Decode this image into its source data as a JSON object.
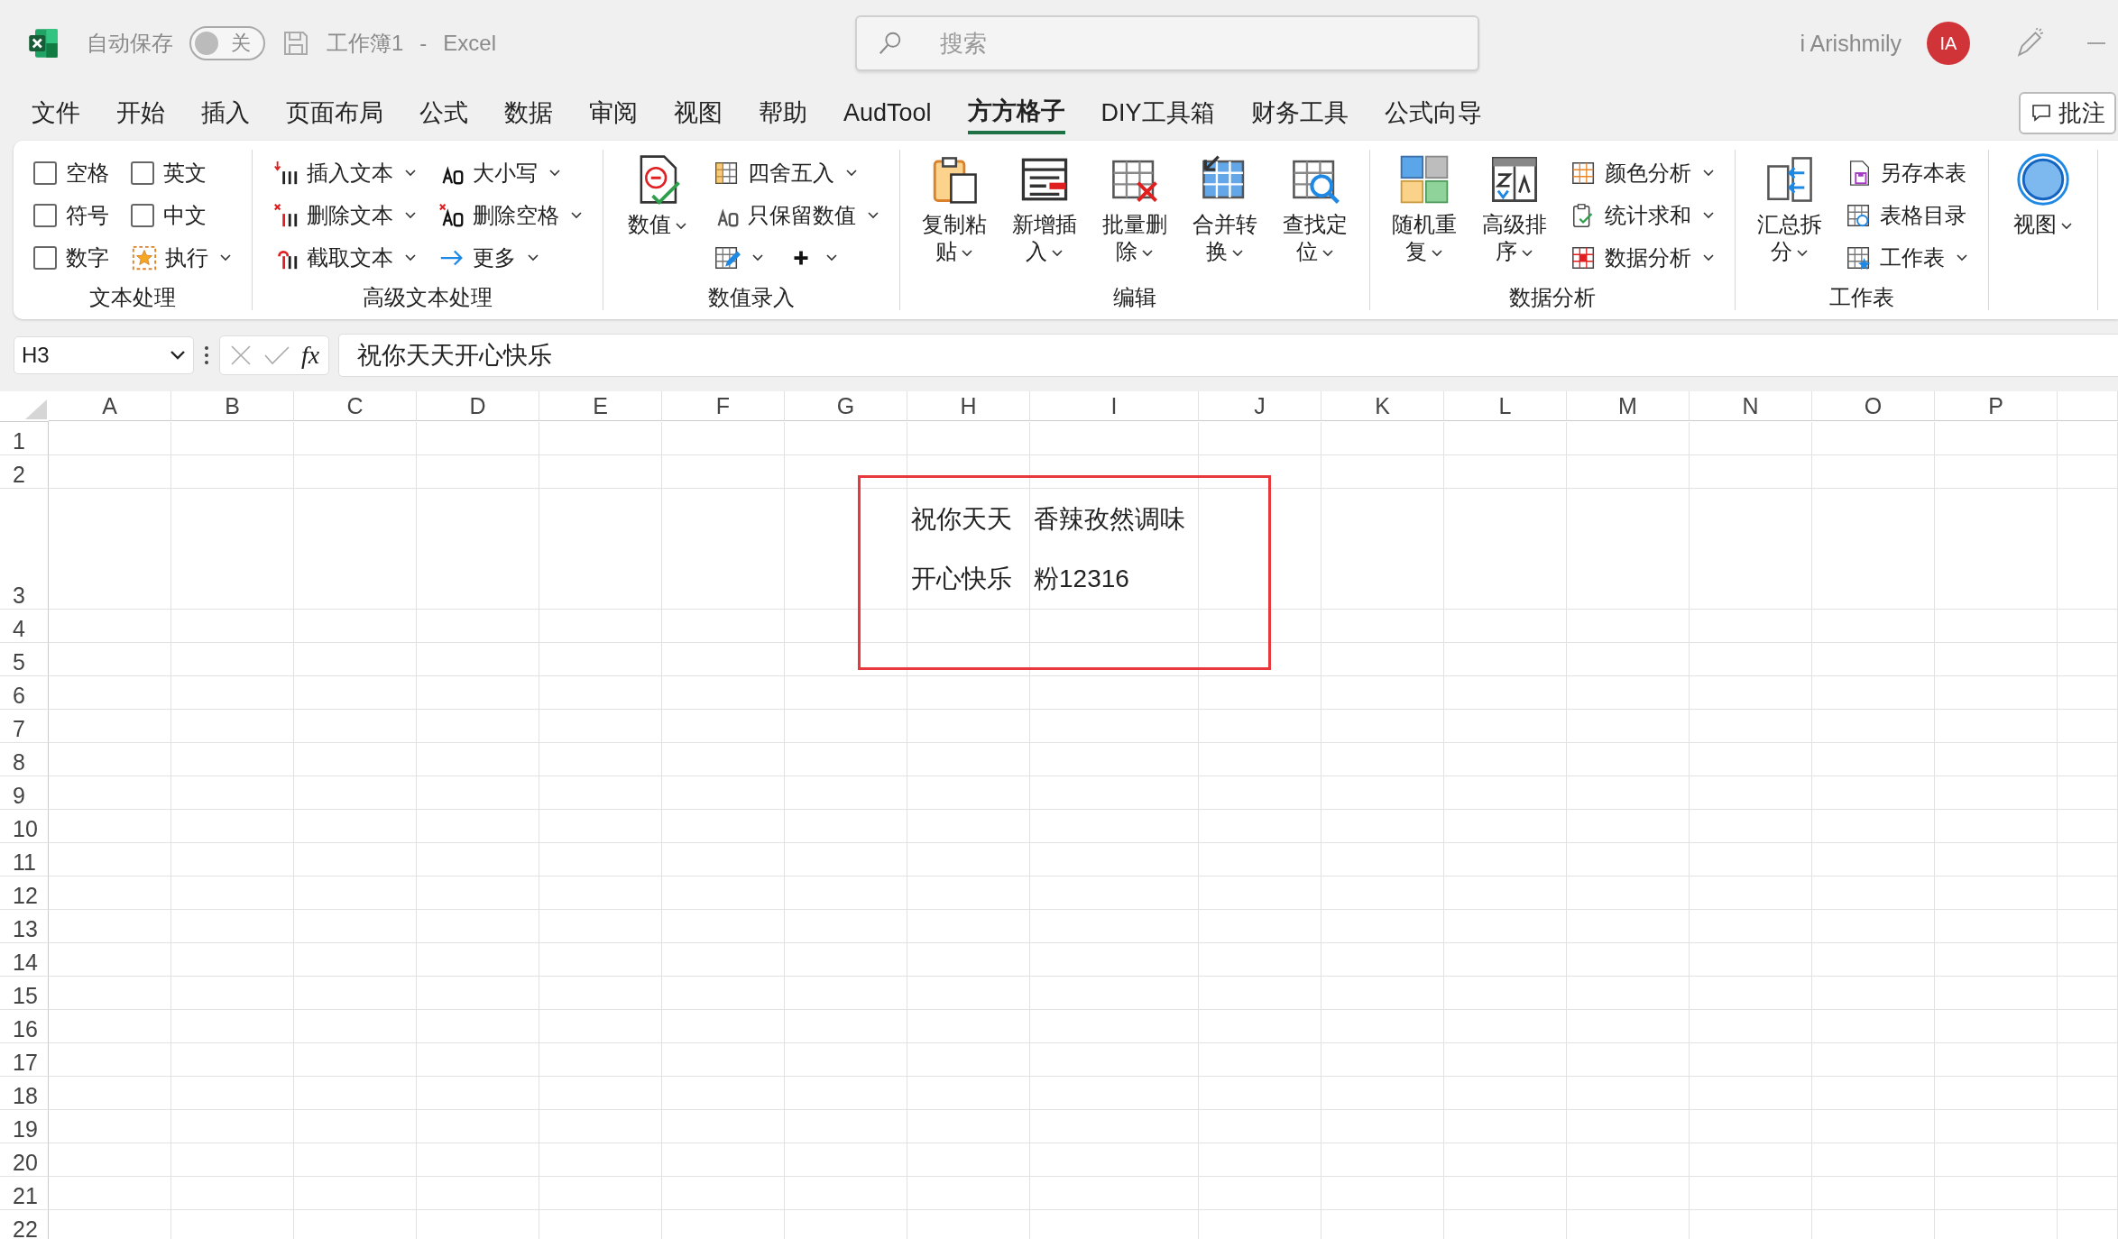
{
  "title_bar": {
    "autosave_label": "自动保存",
    "autosave_toggle": {
      "label": "关",
      "on": false
    },
    "document": "工作簿1",
    "separator": "-",
    "app": "Excel",
    "search": {
      "placeholder": "搜索"
    },
    "user": "i Arishmily",
    "avatar": "IA"
  },
  "menu_tabs": [
    {
      "label": "文件",
      "selected": false
    },
    {
      "label": "开始",
      "selected": false
    },
    {
      "label": "插入",
      "selected": false
    },
    {
      "label": "页面布局",
      "selected": false
    },
    {
      "label": "公式",
      "selected": false
    },
    {
      "label": "数据",
      "selected": false
    },
    {
      "label": "审阅",
      "selected": false
    },
    {
      "label": "视图",
      "selected": false
    },
    {
      "label": "帮助",
      "selected": false
    },
    {
      "label": "AudTool",
      "selected": false
    },
    {
      "label": "方方格子",
      "selected": true
    },
    {
      "label": "DIY工具箱",
      "selected": false
    },
    {
      "label": "财务工具",
      "selected": false
    },
    {
      "label": "公式向导",
      "selected": false
    }
  ],
  "comment_button": "批注",
  "ribbon_groups": [
    {
      "label": "文本处理",
      "items": [
        {
          "kind": "checkbox",
          "label": "空格",
          "checked": false
        },
        {
          "kind": "checkbox",
          "label": "符号",
          "checked": false
        },
        {
          "kind": "checkbox",
          "label": "数字",
          "checked": false
        },
        {
          "kind": "checkbox",
          "label": "英文",
          "checked": false
        },
        {
          "kind": "checkbox",
          "label": "中文",
          "checked": false
        },
        {
          "kind": "small",
          "label": "执行",
          "dropdown": true
        }
      ]
    },
    {
      "label": "高级文本处理",
      "items": [
        {
          "kind": "small",
          "label": "插入文本",
          "dropdown": true
        },
        {
          "kind": "small",
          "label": "删除文本",
          "dropdown": true
        },
        {
          "kind": "small",
          "label": "截取文本",
          "dropdown": true
        },
        {
          "kind": "small",
          "label": "大小写",
          "dropdown": true
        },
        {
          "kind": "small",
          "label": "删除空格",
          "dropdown": true
        },
        {
          "kind": "small",
          "label": "更多",
          "dropdown": true
        }
      ]
    },
    {
      "label": "数值录入",
      "items": [
        {
          "kind": "big",
          "label": "数值",
          "dropdown": true
        },
        {
          "kind": "small",
          "label": "四舍五入",
          "dropdown": true
        },
        {
          "kind": "small",
          "label": "只保留数值",
          "dropdown": true
        },
        {
          "kind": "icon_dropdown",
          "dropdown": true
        },
        {
          "kind": "icon_dropdown",
          "dropdown": true
        }
      ]
    },
    {
      "label": "编辑",
      "items": [
        {
          "kind": "big",
          "label": "复制粘贴",
          "dropdown": true
        },
        {
          "kind": "big",
          "label": "新增插入",
          "dropdown": true
        },
        {
          "kind": "big",
          "label": "批量删除",
          "dropdown": true
        },
        {
          "kind": "big",
          "label": "合并转换",
          "dropdown": true
        },
        {
          "kind": "big",
          "label": "查找定位",
          "dropdown": true
        }
      ]
    },
    {
      "label": "数据分析",
      "items": [
        {
          "kind": "big",
          "label": "随机重复",
          "dropdown": true
        },
        {
          "kind": "big",
          "label": "高级排序",
          "dropdown": true
        },
        {
          "kind": "small",
          "label": "颜色分析",
          "dropdown": true
        },
        {
          "kind": "small",
          "label": "统计求和",
          "dropdown": true
        },
        {
          "kind": "small",
          "label": "数据分析",
          "dropdown": true
        }
      ]
    },
    {
      "label": "工作表",
      "items": [
        {
          "kind": "big",
          "label": "汇总拆分",
          "dropdown": true
        },
        {
          "kind": "small",
          "label": "另存本表",
          "dropdown": false
        },
        {
          "kind": "small",
          "label": "表格目录",
          "dropdown": false
        },
        {
          "kind": "small",
          "label": "工作表",
          "dropdown": true
        }
      ]
    },
    {
      "items": [
        {
          "kind": "big",
          "label": "视图",
          "dropdown": true
        }
      ]
    }
  ],
  "formula_bar": {
    "name_box": "H3",
    "function_label": "fx",
    "formula": "祝你天天开心快乐"
  },
  "sheet": {
    "columns": [
      "A",
      "B",
      "C",
      "D",
      "E",
      "F",
      "G",
      "H",
      "I",
      "J",
      "K",
      "L",
      "M",
      "N",
      "O",
      "P"
    ],
    "rows": [
      {
        "label": "1"
      },
      {
        "label": "2"
      },
      {
        "label": "3",
        "cells": {
          "H": "祝你天天开心快乐",
          "I": "香辣孜然调味粉12316"
        }
      },
      {
        "label": "4"
      },
      {
        "label": "5"
      },
      {
        "label": "6"
      },
      {
        "label": "7"
      },
      {
        "label": "8"
      },
      {
        "label": "9"
      },
      {
        "label": "10"
      },
      {
        "label": "11"
      },
      {
        "label": "12"
      },
      {
        "label": "13"
      },
      {
        "label": "14"
      },
      {
        "label": "15"
      },
      {
        "label": "16"
      },
      {
        "label": "17"
      },
      {
        "label": "18"
      },
      {
        "label": "19"
      },
      {
        "label": "20"
      },
      {
        "label": "21"
      },
      {
        "label": "22"
      }
    ]
  }
}
